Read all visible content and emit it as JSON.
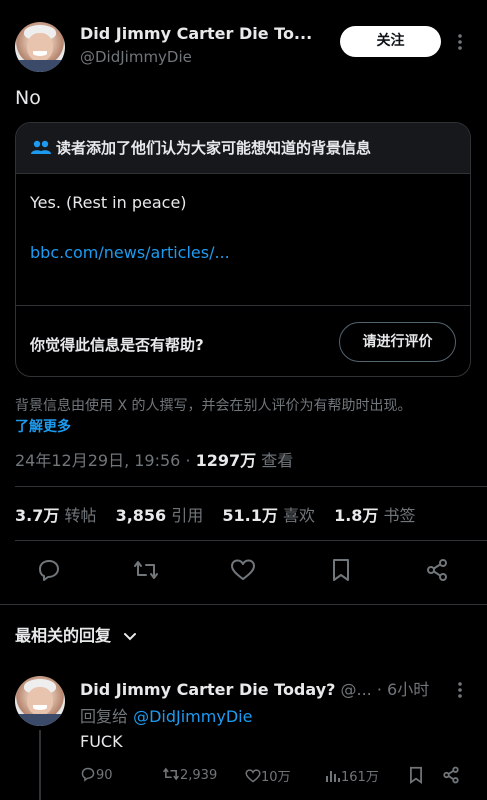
{
  "colors": {
    "background": "#000000",
    "text": "#e7e9ea",
    "secondary": "#71767b",
    "link": "#1d9bf0",
    "border": "#2f3336"
  },
  "post": {
    "display_name": "Did Jimmy Carter Die To...",
    "handle": "@DidJimmyDie",
    "follow_label": "关注",
    "text": "No"
  },
  "note": {
    "header": "读者添加了他们认为大家可能想知道的背景信息",
    "body": "Yes. (Rest in peace)",
    "link": "bbc.com/news/articles/...",
    "question": "你觉得此信息是否有帮助?",
    "rate_label": "请进行评价",
    "footer": "背景信息由使用 X 的人撰写，并会在别人评价为有帮助时出现。",
    "learn_more": "了解更多"
  },
  "meta": {
    "timestamp": "24年12月29日, 19:56 · ",
    "views_num": "1297万",
    "views_label": " 查看"
  },
  "stats": {
    "reposts_num": "3.7万",
    "reposts_label": "转帖",
    "quotes_num": "3,856",
    "quotes_label": "引用",
    "likes_num": "51.1万",
    "likes_label": "喜欢",
    "bookmarks_num": "1.8万",
    "bookmarks_label": "书签"
  },
  "actions": [
    "reply-icon",
    "repost-icon",
    "like-icon",
    "bookmark-icon",
    "share-icon"
  ],
  "replies_section": {
    "label": "最相关的回复"
  },
  "reply": {
    "display_name": "Did Jimmy Carter Die Today?",
    "handle_short": "@...",
    "time": "· 6小时",
    "reply_to_prefix": "回复给 ",
    "reply_to_handle": "@DidJimmyDie",
    "text": "FUCK",
    "replies": "90",
    "reposts": "2,939",
    "likes": "10万",
    "views": "161万"
  }
}
